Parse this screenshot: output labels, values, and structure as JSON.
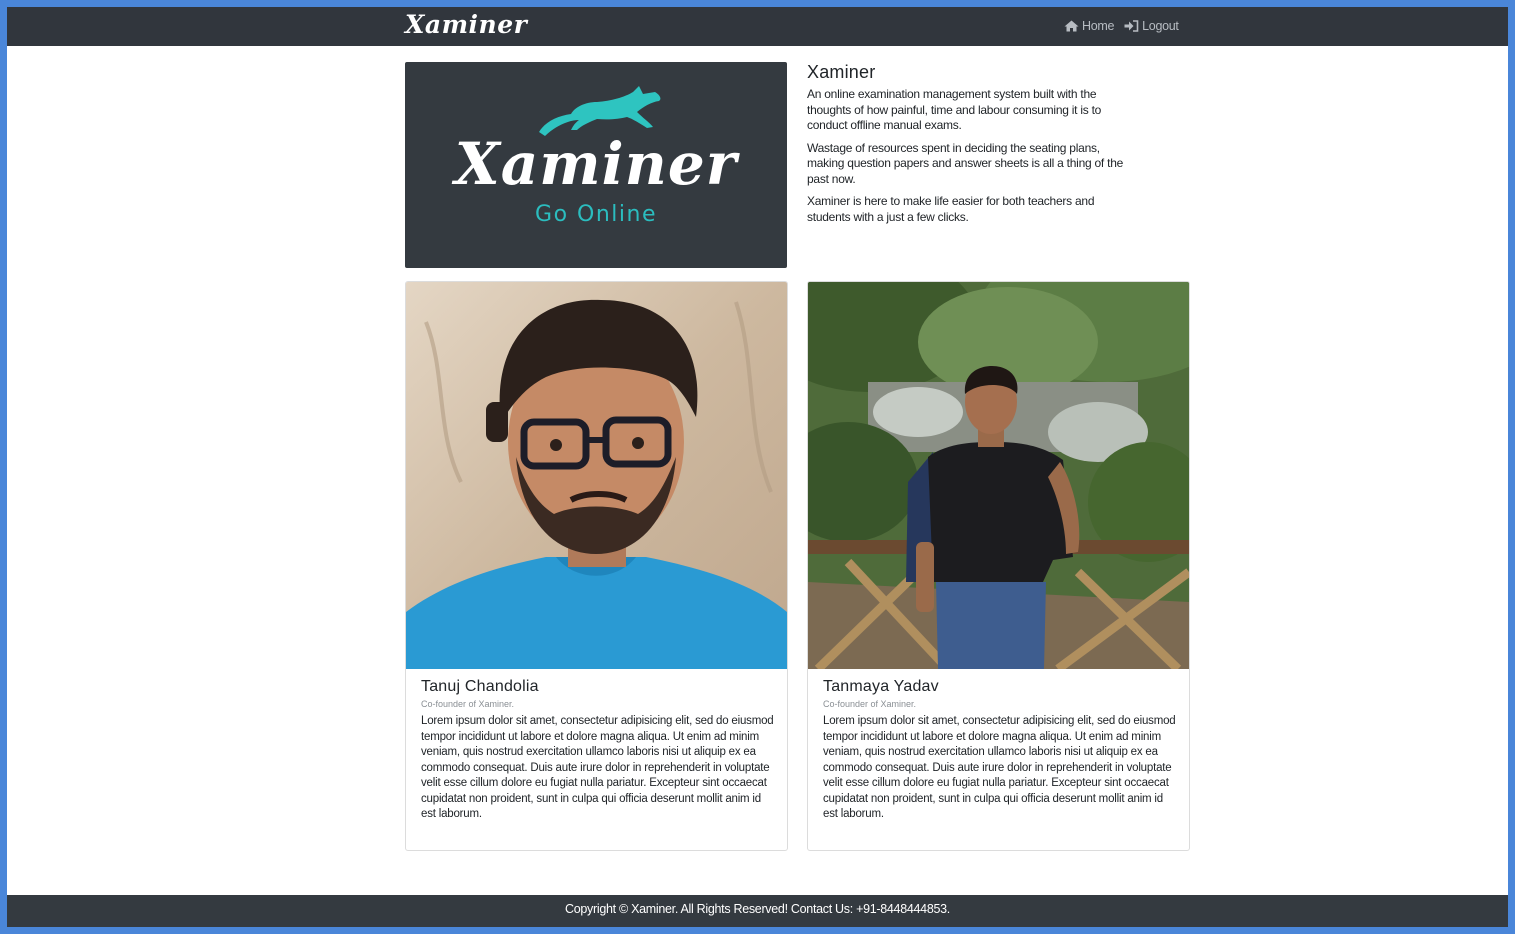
{
  "navbar": {
    "brand": "Xaminer",
    "home_label": "Home",
    "logout_label": "Logout",
    "home_icon": "home-icon",
    "logout_icon": "sign-in-icon"
  },
  "logo": {
    "title": "Xaminer",
    "tagline": "Go Online",
    "accent_color": "#2bbdbf"
  },
  "about": {
    "title": "Xaminer",
    "paragraphs": [
      "An online examination management system built with the thoughts of how painful, time and labour consuming it is to conduct offline manual exams.",
      "Wastage of resources spent in deciding the seating plans, making question papers and answer sheets is all a thing of the past now.",
      "Xaminer is here to make life easier for both teachers and students with a just a few clicks."
    ]
  },
  "founders": [
    {
      "name": "Tanuj Chandolia",
      "role": "Co-founder of Xaminer.",
      "bio": "Lorem ipsum dolor sit amet, consectetur adipisicing elit, sed do eiusmod tempor incididunt ut labore et dolore magna aliqua. Ut enim ad minim veniam, quis nostrud exercitation ullamco laboris nisi ut aliquip ex ea commodo consequat. Duis aute irure dolor in reprehenderit in voluptate velit esse cillum dolore eu fugiat nulla pariatur. Excepteur sint occaecat cupidatat non proident, sunt in culpa qui officia deserunt mollit anim id est laborum."
    },
    {
      "name": "Tanmaya Yadav",
      "role": "Co-founder of Xaminer.",
      "bio": "Lorem ipsum dolor sit amet, consectetur adipisicing elit, sed do eiusmod tempor incididunt ut labore et dolore magna aliqua. Ut enim ad minim veniam, quis nostrud exercitation ullamco laboris nisi ut aliquip ex ea commodo consequat. Duis aute irure dolor in reprehenderit in voluptate velit esse cillum dolore eu fugiat nulla pariatur. Excepteur sint occaecat cupidatat non proident, sunt in culpa qui officia deserunt mollit anim id est laborum."
    }
  ],
  "footer": {
    "text": "Copyright © Xaminer. All Rights Reserved! Contact Us: +91-8448444853."
  }
}
